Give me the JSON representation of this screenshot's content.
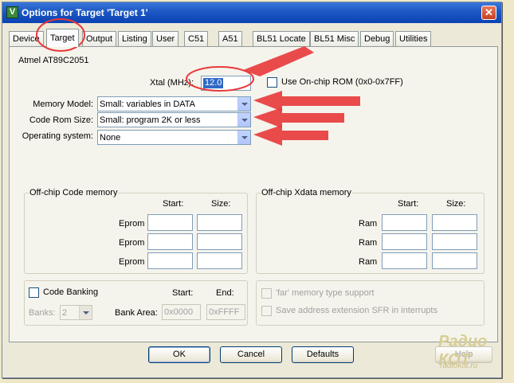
{
  "window": {
    "title": "Options for Target 'Target 1'",
    "app_icon": "V",
    "close_glyph": "✕"
  },
  "tabs": [
    {
      "label": "Device"
    },
    {
      "label": "Target",
      "active": true
    },
    {
      "label": "Output"
    },
    {
      "label": "Listing"
    },
    {
      "label": "User"
    },
    {
      "label": "C51"
    },
    {
      "label": "A51"
    },
    {
      "label": "BL51 Locate"
    },
    {
      "label": "BL51 Misc"
    },
    {
      "label": "Debug"
    },
    {
      "label": "Utilities"
    }
  ],
  "target": {
    "device": "Atmel AT89C2051",
    "xtal_label": "Xtal (MHz):",
    "xtal_value": "12.0",
    "onchip_rom_label": "Use On-chip ROM (0x0-0x7FF)",
    "onchip_rom_checked": false,
    "memory_model_label": "Memory Model:",
    "memory_model_value": "Small: variables in DATA",
    "code_rom_label": "Code Rom Size:",
    "code_rom_value": "Small: program 2K or less",
    "os_label": "Operating system:",
    "os_value": "None"
  },
  "offchip_code": {
    "title": "Off-chip Code memory",
    "start_label": "Start:",
    "size_label": "Size:",
    "rows": [
      "Eprom",
      "Eprom",
      "Eprom"
    ]
  },
  "offchip_xdata": {
    "title": "Off-chip Xdata memory",
    "start_label": "Start:",
    "size_label": "Size:",
    "rows": [
      "Ram",
      "Ram",
      "Ram"
    ]
  },
  "banking": {
    "code_banking_label": "Code Banking",
    "code_banking_checked": false,
    "start_label": "Start:",
    "end_label": "End:",
    "banks_label": "Banks:",
    "banks_value": "2",
    "bank_area_label": "Bank Area:",
    "bank_area_start": "0x0000",
    "bank_area_end": "0xFFFF"
  },
  "far_options": {
    "far_memory_label": "'far' memory type support",
    "save_sfr_label": "Save address extension SFR in interrupts"
  },
  "buttons": {
    "ok": "OK",
    "cancel": "Cancel",
    "defaults": "Defaults",
    "help": "Help"
  },
  "watermark": {
    "logo": "Радио КОТ",
    "url": "radiokot.ru"
  },
  "colors": {
    "annotation_red": "#e8383a",
    "title_bar": "#0b43b2",
    "dialog_bg": "#ece9d8",
    "selection": "#316ac5"
  }
}
